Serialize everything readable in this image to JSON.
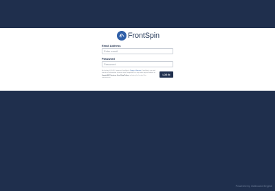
{
  "brand": {
    "name": "FrontSpin",
    "icon": "frontspin-logo-icon"
  },
  "form": {
    "email_label": "Email Address",
    "email_placeholder": "Enter email",
    "email_value": "",
    "password_label": "Password",
    "password_placeholder": "Password",
    "password_value": ""
  },
  "terms": {
    "line1": "By clicking LOG IN, I agree to FrontSpin's ",
    "terms_link": "Terms of Service",
    "line2": ". FrontSpin's use and transfer of information received from Google APIs to any other app will adhere to ",
    "policy_link": "Google API Services User Data Policy",
    "line3": ", including the Limited Use requirements."
  },
  "login_button": "LOG IN",
  "footer": "Powered by Outbound Engine",
  "colors": {
    "background": "#1f2f4d",
    "accent": "#2f5fa8",
    "button": "#1f2f4d"
  }
}
